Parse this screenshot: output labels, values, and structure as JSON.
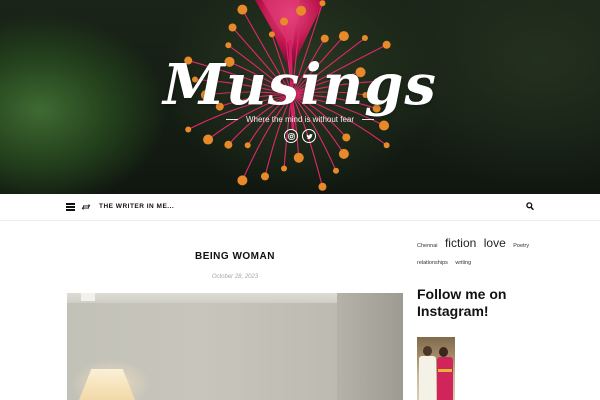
{
  "site": {
    "title": "Musings",
    "tagline": "Where the mind is without fear"
  },
  "social": [
    {
      "icon": "instagram-icon"
    },
    {
      "icon": "twitter-icon"
    }
  ],
  "nav": {
    "menu_icon": "hamburger-menu-icon",
    "repost_icon": "repost-icon",
    "menu_item": "The Writer in Me...",
    "search_icon": "search-icon"
  },
  "post": {
    "title": "Being Woman",
    "date": "October 28, 2023"
  },
  "sidebar": {
    "tags": [
      {
        "label": "Chennai",
        "size": "small"
      },
      {
        "label": "fiction",
        "size": "large"
      },
      {
        "label": "love",
        "size": "large"
      },
      {
        "label": "Poetry",
        "size": "small"
      },
      {
        "label": "relationships",
        "size": "small"
      },
      {
        "label": "writing",
        "size": "small"
      }
    ],
    "follow_heading": "Follow me on Instagram!"
  },
  "colors": {
    "accent": "#d3195c",
    "text": "#111111",
    "muted": "#a6a6a6"
  }
}
